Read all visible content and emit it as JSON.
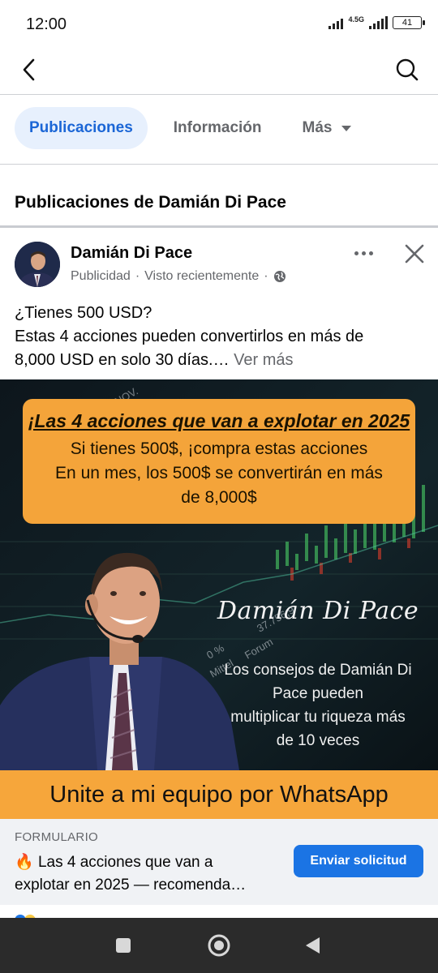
{
  "status_bar": {
    "time": "12:00",
    "network": "4.5G",
    "battery": "41"
  },
  "header": {
    "back_icon": "chevron-left-icon",
    "search_icon": "search-icon"
  },
  "tabs": [
    {
      "label": "Publicaciones",
      "active": true
    },
    {
      "label": "Información",
      "active": false
    },
    {
      "label": "Más",
      "active": false
    }
  ],
  "section": {
    "title": "Publicaciones de Damián Di Pace"
  },
  "post": {
    "author": "Damián Di Pace",
    "sponsored": "Publicidad",
    "separator": "·",
    "seen": "Visto recientemente",
    "text_line1": "¿Tienes 500 USD?",
    "text_line2": "Estas 4 acciones pueden convertirlos en más de",
    "text_line3": "8,000 USD en solo 30 días.…",
    "see_more": " Ver más"
  },
  "ad": {
    "callout_title": "¡Las 4 acciones que van a explotar en 2025",
    "callout_line1": "Si tienes 500$, ¡compra estas acciones",
    "callout_line2": "En un mes, los 500$ se convertirán en más",
    "callout_line3": "de 8,000$",
    "script_name": "Damián Di Pace",
    "tagline_line1": "Los consejos de Damián Di",
    "tagline_line2": "Pace pueden",
    "tagline_line3": "multiplicar tu riqueza más",
    "tagline_line4": "de 10 veces",
    "chart_text_1": "37.756,9",
    "chart_text_2": "Forum",
    "chart_text_3": "23. NOV.",
    "chart_text_4": "0 %",
    "chart_text_5": "Mittel",
    "banner": "Unite a mi equipo por WhatsApp"
  },
  "cta": {
    "kicker": "FORMULARIO",
    "emoji": "🔥",
    "title_line1": "Las 4 acciones que van a",
    "title_line2": "explotar en 2025 — recomenda…",
    "button": "Enviar solicitud"
  },
  "colors": {
    "accent": "#1b74e4",
    "tab_active_bg": "#e7f0fd",
    "tab_active_text": "#1b66d6",
    "orange": "#f6a63b"
  }
}
